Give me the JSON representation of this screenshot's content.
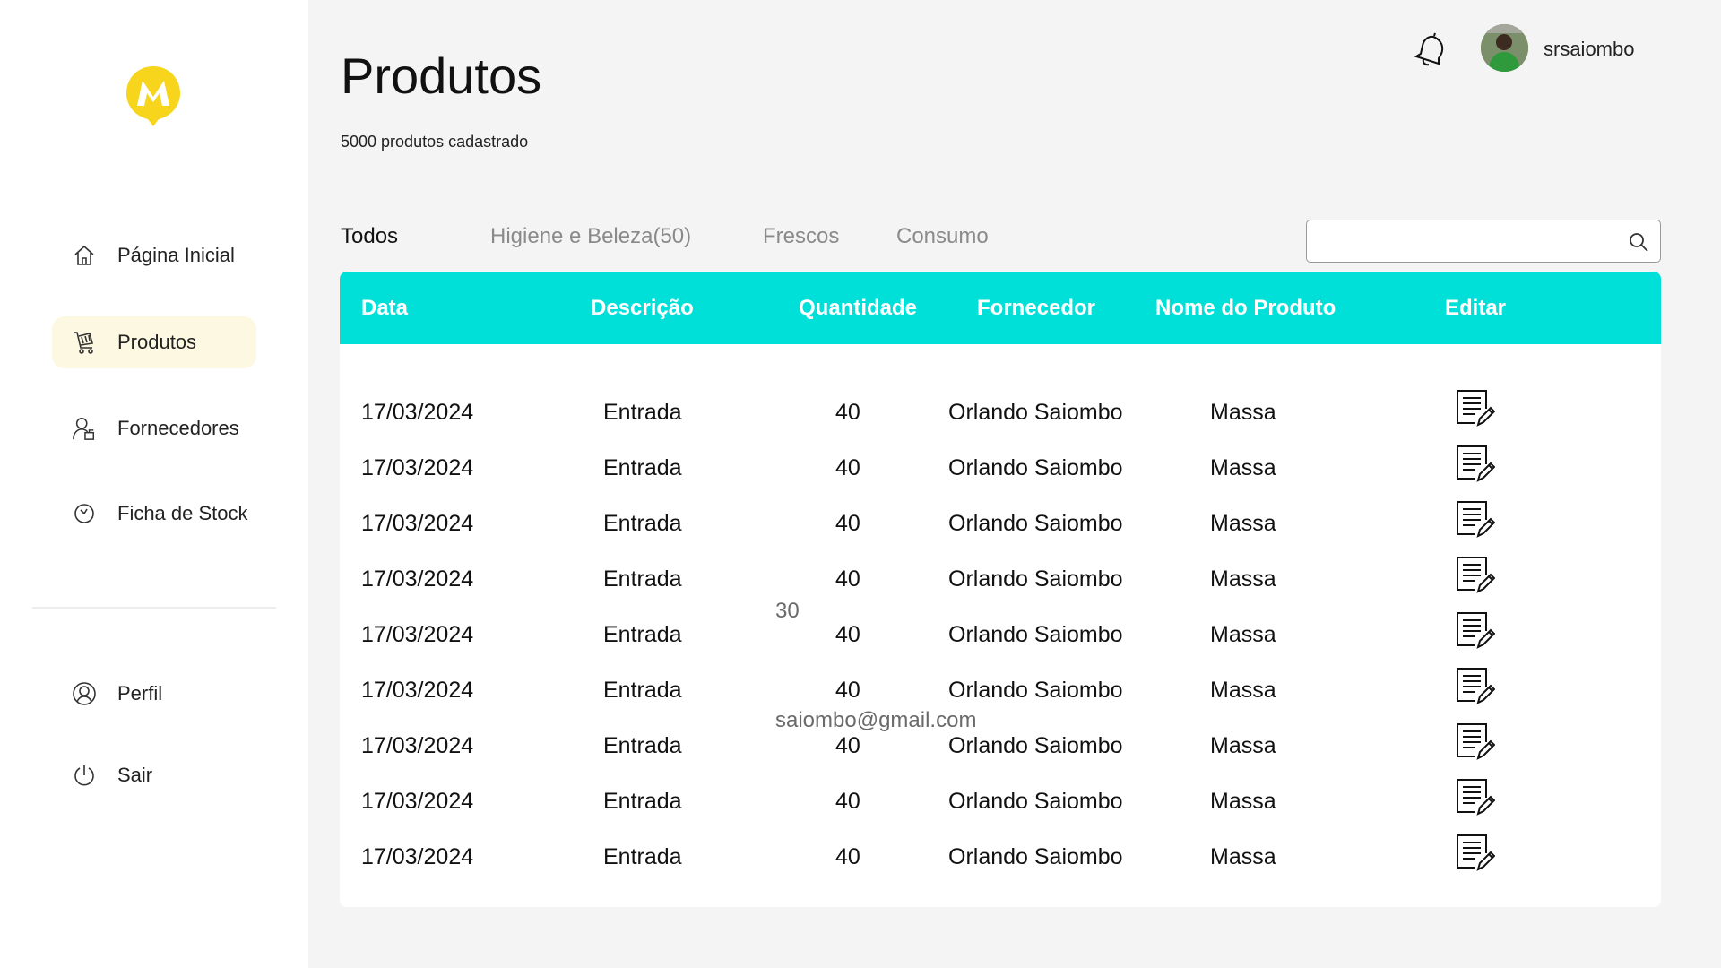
{
  "sidebar": {
    "logo_icon": "m-logo-icon",
    "nav": [
      {
        "label": "Página Inicial",
        "icon": "home-icon",
        "active": false
      },
      {
        "label": "Produtos",
        "icon": "cart-icon",
        "active": true
      },
      {
        "label": "Fornecedores",
        "icon": "supplier-icon",
        "active": false
      },
      {
        "label": "Ficha de Stock",
        "icon": "clock-icon",
        "active": false
      }
    ],
    "bottom_nav": [
      {
        "label": "Perfil",
        "icon": "user-circle-icon"
      },
      {
        "label": "Sair",
        "icon": "power-icon"
      }
    ]
  },
  "header": {
    "title": "Produtos",
    "subtitle": "5000 produtos cadastrado",
    "username": "srsaiombo"
  },
  "tabs": [
    {
      "label": "Todos",
      "active": true
    },
    {
      "label": "Higiene e Beleza(50)",
      "active": false
    },
    {
      "label": "Frescos",
      "active": false
    },
    {
      "label": "Consumo",
      "active": false
    }
  ],
  "search": {
    "value": "",
    "placeholder": ""
  },
  "table": {
    "columns": [
      "Data",
      "Descrição",
      "Quantidade",
      "Fornecedor",
      "Nome do Produto",
      "Editar"
    ],
    "rows": [
      {
        "data": "17/03/2024",
        "descricao": "Entrada",
        "quantidade": "40",
        "fornecedor": "Orlando Saiombo",
        "produto": "Massa"
      },
      {
        "data": "17/03/2024",
        "descricao": "Entrada",
        "quantidade": "40",
        "fornecedor": "Orlando Saiombo",
        "produto": "Massa"
      },
      {
        "data": "17/03/2024",
        "descricao": "Entrada",
        "quantidade": "40",
        "fornecedor": "Orlando Saiombo",
        "produto": "Massa"
      },
      {
        "data": "17/03/2024",
        "descricao": "Entrada",
        "quantidade": "40",
        "fornecedor": "Orlando Saiombo",
        "produto": "Massa"
      },
      {
        "data": "17/03/2024",
        "descricao": "Entrada",
        "quantidade": "40",
        "fornecedor": "Orlando Saiombo",
        "produto": "Massa"
      },
      {
        "data": "17/03/2024",
        "descricao": "Entrada",
        "quantidade": "40",
        "fornecedor": "Orlando Saiombo",
        "produto": "Massa"
      },
      {
        "data": "17/03/2024",
        "descricao": "Entrada",
        "quantidade": "40",
        "fornecedor": "Orlando Saiombo",
        "produto": "Massa"
      },
      {
        "data": "17/03/2024",
        "descricao": "Entrada",
        "quantidade": "40",
        "fornecedor": "Orlando Saiombo",
        "produto": "Massa"
      },
      {
        "data": "17/03/2024",
        "descricao": "Entrada",
        "quantidade": "40",
        "fornecedor": "Orlando Saiombo",
        "produto": "Massa"
      }
    ]
  },
  "overlay": {
    "number": "30",
    "email": "saiombo@gmail.com"
  },
  "colors": {
    "accent": "#00e0d8",
    "logo": "#f7d51d",
    "active_nav_bg": "#fdf8e2"
  }
}
